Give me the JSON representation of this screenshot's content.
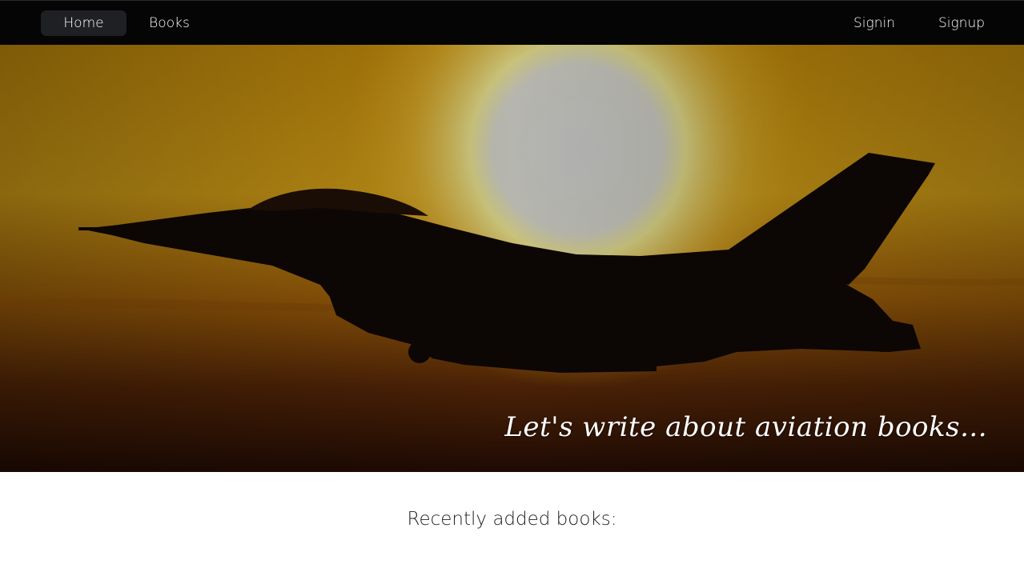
{
  "nav": {
    "left": [
      {
        "label": "Home",
        "active": true
      },
      {
        "label": "Books",
        "active": false
      }
    ],
    "right": [
      {
        "label": "Signin"
      },
      {
        "label": "Signup"
      }
    ]
  },
  "hero": {
    "image": "fighter-jet-silhouette-at-sunset",
    "tagline": "Let's write about aviation books..."
  },
  "content": {
    "section_title": "Recently added books:"
  },
  "colors": {
    "navbar_bg": "#050505",
    "active_pill": "#1f2023",
    "sky_top": "#b8860b",
    "sky_bottom": "#2a1005"
  }
}
